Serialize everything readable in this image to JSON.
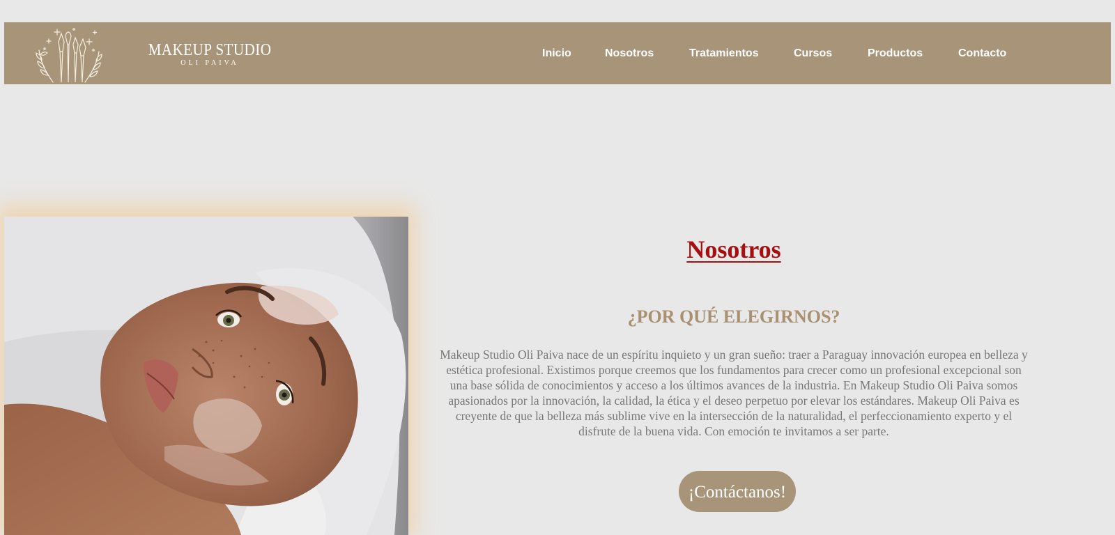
{
  "brand": {
    "name": "MAKEUP STUDIO",
    "tagline": "OLI PAIVA",
    "logo_icon": "makeup-brushes-icon"
  },
  "nav": {
    "items": [
      {
        "label": "Inicio"
      },
      {
        "label": "Nosotros"
      },
      {
        "label": "Tratamientos"
      },
      {
        "label": "Cursos"
      },
      {
        "label": "Productos"
      },
      {
        "label": "Contacto"
      }
    ]
  },
  "hero": {
    "image": "woman-facial-treatment-photo"
  },
  "about": {
    "title": "Nosotros",
    "subtitle": "¿POR QUÉ ELEGIRNOS?",
    "paragraph": "Makeup Studio Oli Paiva nace de un espíritu inquieto y un gran sueño: traer a Paraguay innovación europea en belleza y estética profesional. Existimos porque creemos que los fundamentos para crecer como un profesional excepcional son una base sólida de conocimientos y acceso a los últimos avances de la industria. En Makeup Studio Oli Paiva somos apasionados por la innovación, la calidad, la ética y el deseo perpetuo por elevar los estándares. Makeup Oli Paiva es creyente de que la belleza más sublime vive en la intersección de la naturalidad, el perfeccionamiento experto y el disfrute de la buena vida. Con emoción te invitamos a ser parte.",
    "cta_label": "¡Contáctanos!"
  },
  "colors": {
    "header_bg": "#a89478",
    "page_bg": "#e8e8e8",
    "title_red": "#a50f0f",
    "subtitle_gold": "#a89070",
    "body_text": "#777777"
  }
}
